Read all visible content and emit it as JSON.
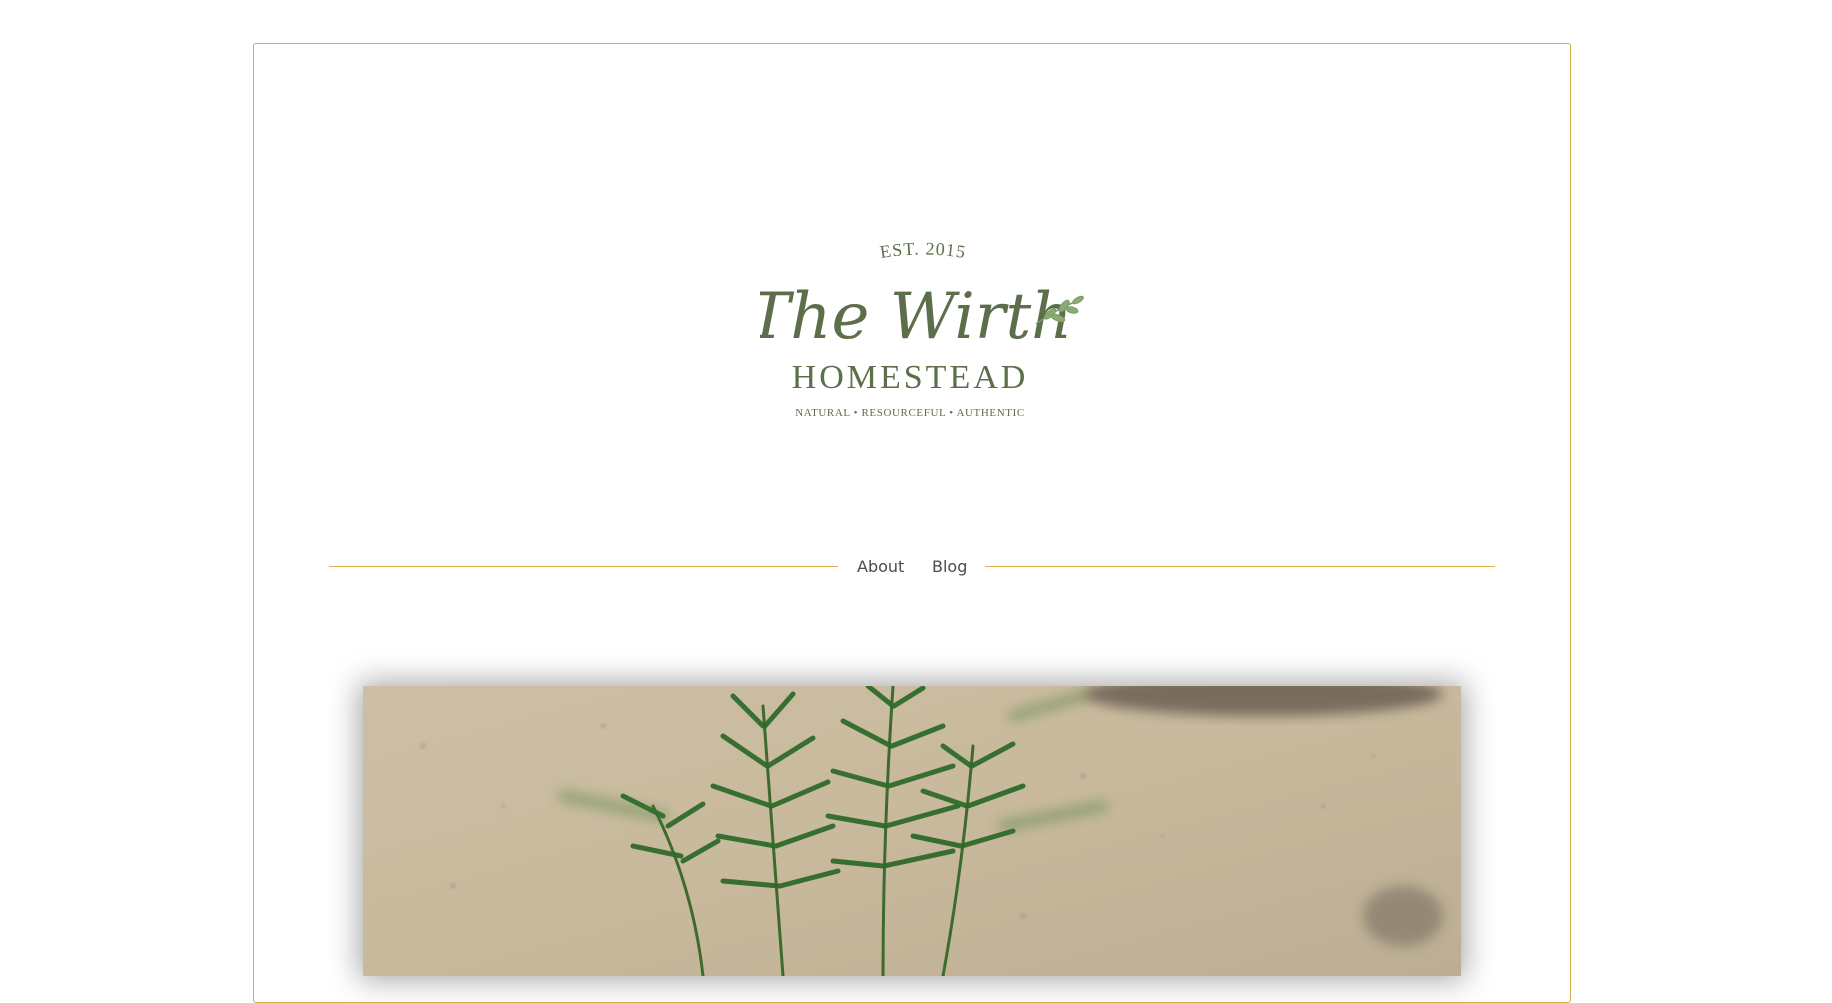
{
  "logo": {
    "established": "EST. 2015",
    "script_name": "The Wirth",
    "name": "HOMESTEAD",
    "tagline": "NATURAL • RESOURCEFUL • AUTHENTIC"
  },
  "nav": {
    "items": [
      {
        "label": "About"
      },
      {
        "label": "Blog"
      }
    ]
  },
  "colors": {
    "accent": "#d9b048",
    "brand_green": "#5c6e4a",
    "text": "#4b4b4b"
  },
  "hero": {
    "image": "rosemary-plant-photo"
  }
}
